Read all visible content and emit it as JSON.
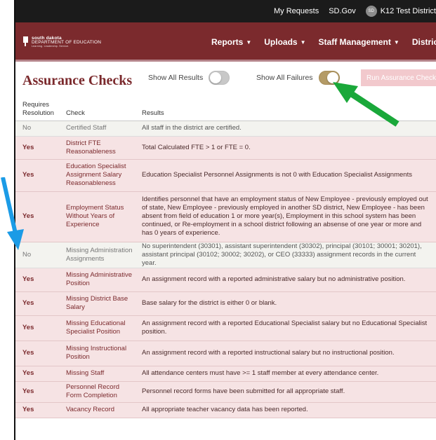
{
  "topbar": {
    "links": [
      "My Requests",
      "SD.Gov"
    ],
    "user_initials": "SD",
    "user_name": "K12 Test District"
  },
  "logo": {
    "line1": "south dakota",
    "line2": "DEPARTMENT OF EDUCATION",
    "line3": "Learning. Leadership. Service."
  },
  "nav": [
    {
      "label": "Reports"
    },
    {
      "label": "Uploads"
    },
    {
      "label": "Staff Management"
    },
    {
      "label": "District Information"
    }
  ],
  "page": {
    "title": "Assurance Checks",
    "show_all_results_label": "Show All Results",
    "show_all_results_on": false,
    "show_all_failures_label": "Show All Failures",
    "show_all_failures_on": true,
    "run_button": "Run Assurance Checks"
  },
  "table": {
    "headers": [
      "Requires Resolution",
      "Check",
      "Results"
    ],
    "rows": [
      {
        "requires": "No",
        "check": "Certified Staff",
        "result": "All staff in the district are certified."
      },
      {
        "requires": "Yes",
        "check": "District FTE Reasonableness",
        "result": "Total Calculated FTE > 1 or FTE = 0."
      },
      {
        "requires": "Yes",
        "check": "Education Specialist Assignment Salary Reasonableness",
        "result": "Education Specialist Personnel Assignments is not 0 with Education Specialist Assignments"
      },
      {
        "requires": "Yes",
        "check": "Employment Status Without Years of Experience",
        "result": "Identifies personnel that have an employment status of New Employee - previously employed out of state, New Employee - previously employed in another SD district, New Employee - has been absent from field of education 1 or more year(s), Employment in this school system has been continued, or Re-employment in a school district following an absense of one year or more and has 0 years of experience."
      },
      {
        "requires": "No",
        "check": "Missing Administration Assignments",
        "result": "No superintendent (30301), assistant superintendent (30302), principal (30101; 30001; 30201), assistant principal (30102; 30002; 30202), or CEO (33333) assignment records in the current year."
      },
      {
        "requires": "Yes",
        "check": "Missing Administrative Position",
        "result": "An assignment record with a reported administrative salary but no administrative position."
      },
      {
        "requires": "Yes",
        "check": "Missing District Base Salary",
        "result": "Base salary for the district is either 0 or blank."
      },
      {
        "requires": "Yes",
        "check": "Missing Educational Specialist Position",
        "result": "An assignment record with a reported Educational Specialist salary but no Educational Specialist position."
      },
      {
        "requires": "Yes",
        "check": "Missing Instructional Position",
        "result": "An assignment record with a reported instructional salary but no instructional position."
      },
      {
        "requires": "Yes",
        "check": "Missing Staff",
        "result": "All attendance centers must have >= 1 staff member at every attendance center."
      },
      {
        "requires": "Yes",
        "check": "Personnel Record Form Completion",
        "result": "Personnel record forms have been submitted for all appropriate staff."
      },
      {
        "requires": "Yes",
        "check": "Vacancy Record",
        "result": "All appropriate teacher vacancy data has been reported."
      }
    ]
  },
  "annotations": {
    "green_arrow_color": "#1aa83a",
    "blue_arrow_color": "#1b9be6"
  },
  "colors": {
    "brand": "#7b2a2d",
    "failure_row": "#f6e3e4",
    "pass_row": "#f3f3ef",
    "toggle_on": "#b49b66"
  }
}
